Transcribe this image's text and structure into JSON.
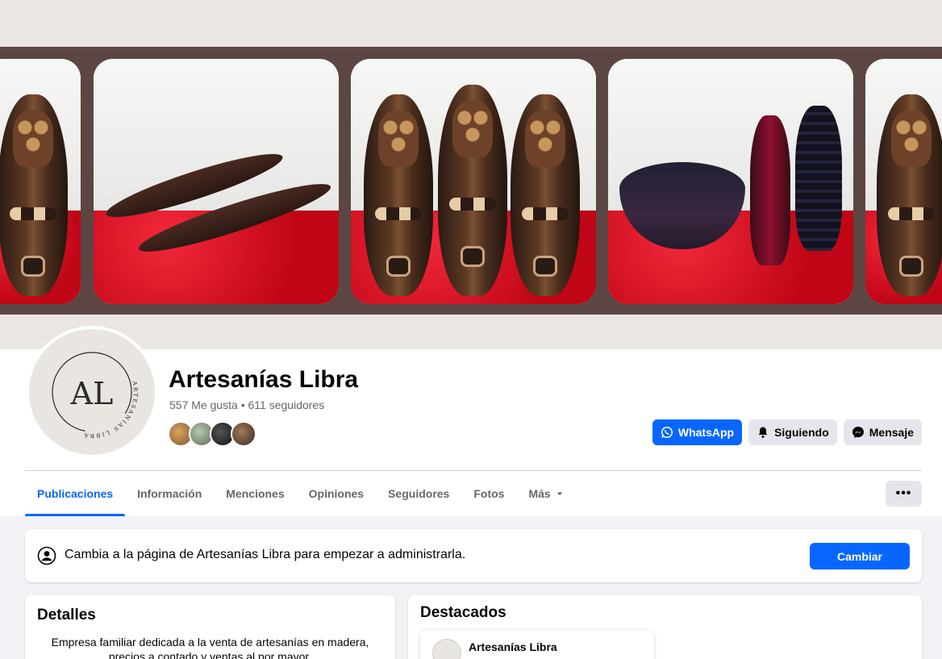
{
  "page": {
    "name": "Artesanías Libra",
    "stats": "557 Me gusta • 611 seguidores",
    "avatar_monogram": "AL",
    "avatar_ring_text": "ARTESANIAS LIBRA"
  },
  "actions": {
    "whatsapp": "WhatsApp",
    "following": "Siguiendo",
    "message": "Mensaje",
    "more": "•••"
  },
  "tabs": [
    {
      "label": "Publicaciones",
      "active": true
    },
    {
      "label": "Información"
    },
    {
      "label": "Menciones"
    },
    {
      "label": "Opiniones"
    },
    {
      "label": "Seguidores"
    },
    {
      "label": "Fotos"
    },
    {
      "label": "Más"
    }
  ],
  "banner": {
    "text": "Cambia a la página de Artesanías Libra para empezar a administrarla.",
    "button": "Cambiar"
  },
  "details": {
    "title": "Detalles",
    "text": "Empresa familiar dedicada a la venta de artesanías en madera, precios a contado y ventas al por mayor."
  },
  "featured": {
    "title": "Destacados",
    "item_name": "Artesanías Libra"
  },
  "colors": {
    "accent": "#0866ff",
    "cover_bg": "#ebe6e3",
    "cover_frame": "#5b4643"
  },
  "icons": {
    "whatsapp": "whatsapp-icon",
    "following": "bell-icon",
    "message": "messenger-icon",
    "more_tab": "caret-down-icon",
    "banner": "profile-switch-icon"
  }
}
